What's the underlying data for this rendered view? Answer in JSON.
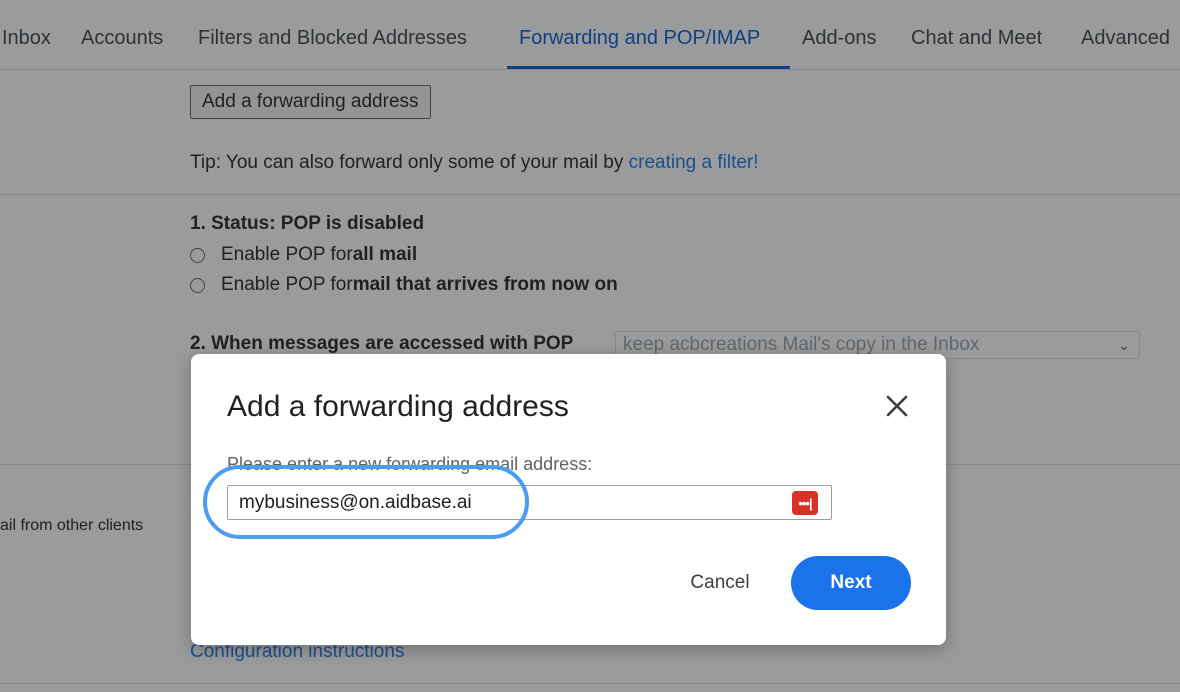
{
  "tabs": [
    {
      "label": "Inbox"
    },
    {
      "label": "Accounts"
    },
    {
      "label": "Filters and Blocked Addresses"
    },
    {
      "label": "Forwarding and POP/IMAP"
    },
    {
      "label": "Add-ons"
    },
    {
      "label": "Chat and Meet"
    },
    {
      "label": "Advanced"
    }
  ],
  "active_tab": "Forwarding and POP/IMAP",
  "forwarding": {
    "add_button_label": "Add a forwarding address",
    "tip_text": "Tip: You can also forward only some of your mail by ",
    "tip_link": "creating a filter!"
  },
  "pop": {
    "status_label": "1. Status: POP is disabled",
    "option1_prefix": "Enable POP for ",
    "option1_bold": "all mail",
    "option2_prefix": "Enable POP for ",
    "option2_bold": "mail that arrives from now on",
    "access_label": "2. When messages are accessed with POP",
    "access_select_value": "keep acbcreations Mail's copy in the Inbox"
  },
  "sidebar_label": "ail from other clients",
  "config_link": "Configuration instructions",
  "dialog": {
    "title": "Add a forwarding address",
    "prompt": "Please enter a new forwarding email address:",
    "email_value": "mybusiness@on.aidbase.ai",
    "cancel_label": "Cancel",
    "next_label": "Next"
  },
  "colors": {
    "accent": "#1a73e8",
    "active_tab": "#0b57d0",
    "highlight_ring": "#4a9cf5",
    "password_icon": "#d93025"
  },
  "icons": {
    "close": "close-icon",
    "password_manager": "password-manager-icon",
    "select_chevron": "chevron-down-icon"
  }
}
